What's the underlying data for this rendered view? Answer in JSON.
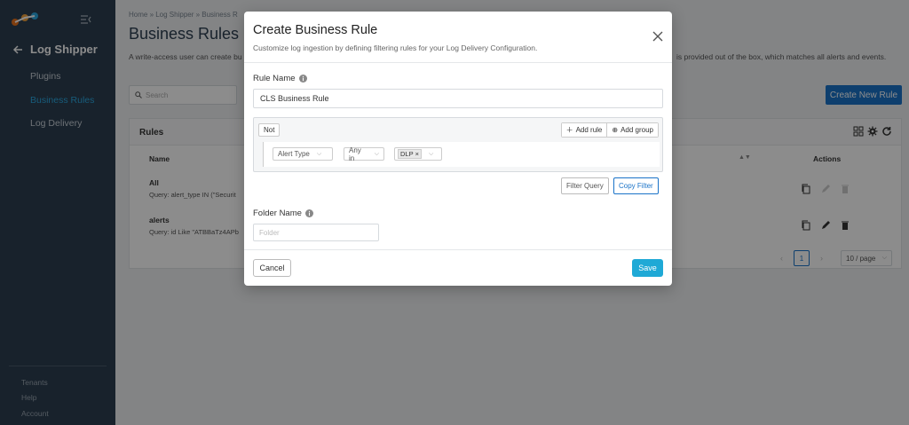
{
  "sidebar": {
    "back_title": "Log Shipper",
    "items": [
      {
        "label": "Plugins"
      },
      {
        "label": "Business Rules"
      },
      {
        "label": "Log Delivery"
      }
    ],
    "bottom_items": [
      {
        "label": "Tenants"
      },
      {
        "label": "Help"
      },
      {
        "label": "Account"
      }
    ]
  },
  "main": {
    "breadcrumb": "Home  »  Log Shipper  »  Business R",
    "title": "Business Rules",
    "description": "A write-access user can create bu",
    "description_right": "is provided out of the box, which matches all alerts and events.",
    "search_placeholder": "Search",
    "create_button": "Create New Rule",
    "table": {
      "label": "Rules",
      "columns": {
        "name": "Name",
        "actions": "Actions"
      },
      "rows": [
        {
          "name": "All",
          "query": "Query: alert_type IN (\"Securit"
        },
        {
          "name": "alerts",
          "query": "Query: id Like \"ATBBaTz4APb"
        }
      ]
    },
    "pagination": {
      "current_page": "1",
      "per_page": "10 / page"
    }
  },
  "modal": {
    "title": "Create Business Rule",
    "subtitle": "Customize log ingestion by defining filtering rules for your Log Delivery Configuration.",
    "rule_name_label": "Rule Name",
    "rule_name_value": "CLS Business Rule",
    "query_builder": {
      "not_label": "Not",
      "add_rule_label": "Add rule",
      "add_group_label": "Add group",
      "field_value": "Alert Type",
      "operator_value": "Any in",
      "value_tag": "DLP"
    },
    "filter_query_label": "Filter Query",
    "copy_filter_label": "Copy Filter",
    "folder_name_label": "Folder Name",
    "folder_placeholder": "Folder",
    "cancel_label": "Cancel",
    "save_label": "Save"
  },
  "colors": {
    "sidebar_bg": "#2c3e50",
    "accent": "#1a73c8",
    "save": "#1fa9d6",
    "active_nav": "#2aa8e0"
  }
}
